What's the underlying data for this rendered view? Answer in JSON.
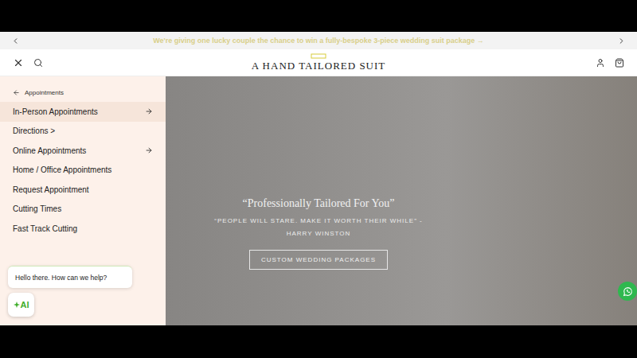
{
  "announcement": {
    "text": "We're giving one lucky couple the chance to win a fully-bespoke 3-piece wedding suit package →"
  },
  "header": {
    "logo": "A HAND TAILORED SUIT"
  },
  "menu": {
    "back": "Appointments",
    "items": [
      {
        "label": "In-Person Appointments",
        "kind": "submenu",
        "selected": true
      },
      {
        "label": "Directions >",
        "kind": "link",
        "selected": false
      },
      {
        "label": "Online Appointments",
        "kind": "submenu",
        "selected": false
      },
      {
        "label": "Home / Office Appointments",
        "kind": "link",
        "selected": false
      },
      {
        "label": "Request Appointment",
        "kind": "link",
        "selected": false
      },
      {
        "label": "Cutting Times",
        "kind": "link",
        "selected": false
      },
      {
        "label": "Fast Track Cutting",
        "kind": "link",
        "selected": false
      }
    ]
  },
  "hero": {
    "title": "“Professionally Tailored For You”",
    "quote": "“PEOPLE WILL STARE. MAKE IT WORTH THEIR WHILE” - HARRY WINSTON",
    "button": "CUSTOM WEDDING PACKAGES"
  },
  "chat": {
    "greeting": "Hello there. How can we help?",
    "badge": "AI"
  }
}
